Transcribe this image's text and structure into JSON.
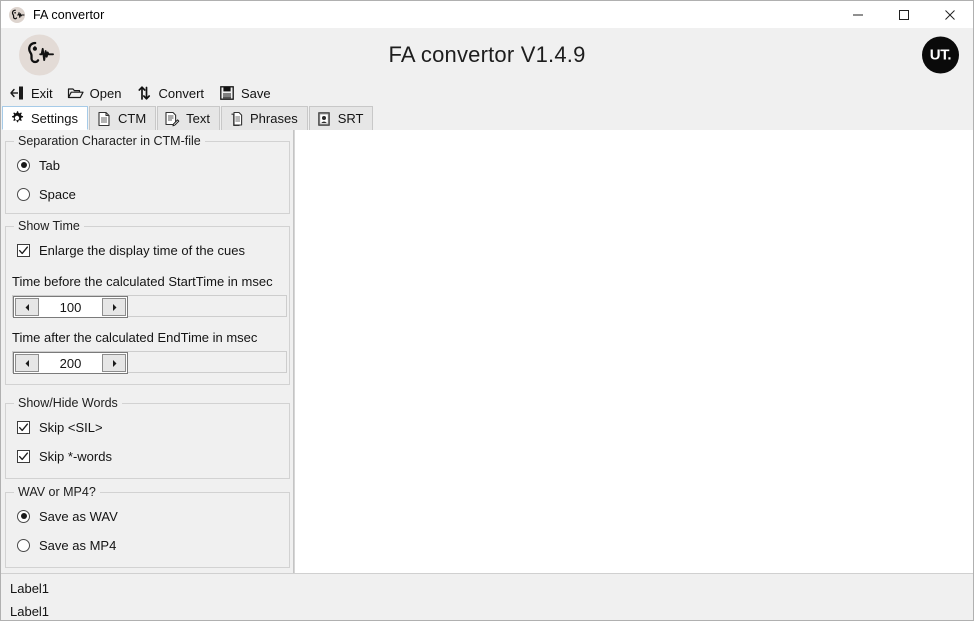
{
  "window": {
    "title": "FA convertor",
    "icon": "ear-waveform-icon",
    "controls": {
      "minimize": "minimize-icon",
      "maximize": "maximize-icon",
      "close": "close-icon"
    }
  },
  "header": {
    "title": "FA convertor V1.4.9",
    "left_logo": "ear-waveform-logo",
    "right_logo_text": "UT.",
    "bg_color": "#f0f0f0",
    "left_logo_bg": "#e3dbd6",
    "right_logo_bg": "#0a0a0a"
  },
  "toolbar": {
    "items": [
      {
        "label": "Exit",
        "icon": "exit-door-icon"
      },
      {
        "label": "Open",
        "icon": "open-folder-icon"
      },
      {
        "label": "Convert",
        "icon": "convert-arrows-icon"
      },
      {
        "label": "Save",
        "icon": "save-floppy-icon"
      }
    ]
  },
  "tabs": {
    "active_index": 0,
    "items": [
      {
        "label": "Settings",
        "icon": "gear-icon"
      },
      {
        "label": "CTM",
        "icon": "document-icon"
      },
      {
        "label": "Text",
        "icon": "document-pencil-icon"
      },
      {
        "label": "Phrases",
        "icon": "documents-stack-icon"
      },
      {
        "label": "SRT",
        "icon": "subtitle-document-icon"
      }
    ],
    "active_border_color": "#a6cbe8"
  },
  "settings": {
    "separation_group": {
      "legend": "Separation Character in CTM-file",
      "options": [
        {
          "label": "Tab",
          "selected": true
        },
        {
          "label": "Space",
          "selected": false
        }
      ]
    },
    "show_time_group": {
      "legend": "Show Time",
      "enlarge_checkbox": {
        "label": "Enlarge the display time of the cues",
        "checked": true
      },
      "before_label": "Time before the calculated StartTime in msec",
      "before_value": "100",
      "after_label": "Time after the calculated EndTime in msec",
      "after_value": "200",
      "spin_left_icon": "arrow-left-icon",
      "spin_right_icon": "arrow-right-icon"
    },
    "show_hide_group": {
      "legend": "Show/Hide Words",
      "options": [
        {
          "label": "Skip <SIL>",
          "checked": true
        },
        {
          "label": "Skip *-words",
          "checked": true
        }
      ]
    },
    "wav_mp4_group": {
      "legend": "WAV or MP4?",
      "options": [
        {
          "label": "Save as WAV",
          "selected": true
        },
        {
          "label": "Save as MP4",
          "selected": false
        }
      ]
    }
  },
  "content": {
    "bg_color": "#ffffff"
  },
  "status": {
    "line1": "Label1",
    "line2": "Label1"
  }
}
